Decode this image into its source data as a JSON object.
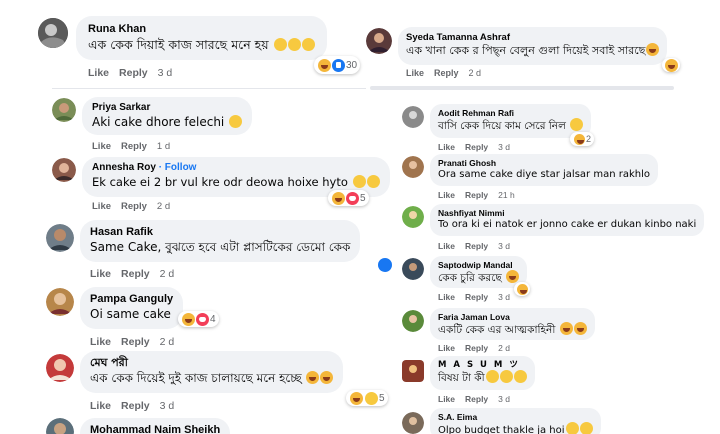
{
  "left": {
    "comments": [
      {
        "name": "Runa Khan",
        "text": "এক কেক দিয়াই কাজ সারছে মনে হয়",
        "like": "Like",
        "reply": "Reply",
        "time": "3 d",
        "reactions": "30"
      },
      {
        "name": "Priya Sarkar",
        "text": "Aki cake dhore felechi",
        "like": "Like",
        "reply": "Reply",
        "time": "1 d",
        "reactions": ""
      },
      {
        "name": "Annesha Roy",
        "follow": "· Follow",
        "text": "Ek cake ei 2 br vul kre odr deowa hoixe hyto",
        "like": "Like",
        "reply": "Reply",
        "time": "2 d",
        "reactions": "5"
      },
      {
        "name": "Hasan Rafik",
        "text": "Same Cake, বুঝতে হবে এটা প্লাসটিকের ডেমো কেক",
        "like": "Like",
        "reply": "Reply",
        "time": "2 d",
        "reactions": ""
      },
      {
        "name": "Pampa Ganguly",
        "text": "Oi same cake",
        "like": "Like",
        "reply": "Reply",
        "time": "2 d",
        "reactions": "4"
      },
      {
        "name": "মেঘ পরী",
        "text": "এক কেক দিয়েই দুই কাজ চালায়ছে মনে হচ্ছে",
        "like": "Like",
        "reply": "Reply",
        "time": "3 d",
        "reactions": "5"
      },
      {
        "name": "Mohammad Naim Sheikh",
        "text": "",
        "like": "",
        "reply": "",
        "time": "",
        "reactions": ""
      }
    ]
  },
  "right": {
    "comments": [
      {
        "name": "Syeda Tamanna Ashraf",
        "text": "এক খানা কেক র পিছ্ন বেলুন গুলা দিয়েই সবাই সারছে",
        "like": "Like",
        "reply": "Reply",
        "time": "2 d",
        "reactions": ""
      },
      {
        "name": "Aodit Rehman Rafi",
        "text": "বাসি কেক দিয়ে কাম সেরে নিল",
        "like": "Like",
        "reply": "Reply",
        "time": "3 d",
        "reactions": "2"
      },
      {
        "name": "Pranati Ghosh",
        "text": "Ora same cake diye star jalsar man rakhlo",
        "like": "Like",
        "reply": "Reply",
        "time": "21 h",
        "reactions": ""
      },
      {
        "name": "Nashfiyat Nimmi",
        "text": "To ora ki ei natok er jonno cake er dukan kinbo naki",
        "like": "Like",
        "reply": "Reply",
        "time": "3 d",
        "reactions": ""
      },
      {
        "name": "Saptodwip Mandal",
        "text": "কেক চুরি করছে",
        "like": "Like",
        "reply": "Reply",
        "time": "3 d",
        "reactions": ""
      },
      {
        "name": "Faria Jaman Lova",
        "text": "একটি কেক এর আত্মকাহিনী",
        "like": "Like",
        "reply": "Reply",
        "time": "2 d",
        "reactions": ""
      },
      {
        "name": "M A S U M ツ",
        "text": "বিষয় টা কী",
        "like": "Like",
        "reply": "Reply",
        "time": "3 d",
        "reactions": ""
      },
      {
        "name": "S.A. Eima",
        "text": "Olpo budget thakle ja hoi",
        "like": "",
        "reply": "",
        "time": "",
        "reactions": ""
      }
    ]
  }
}
